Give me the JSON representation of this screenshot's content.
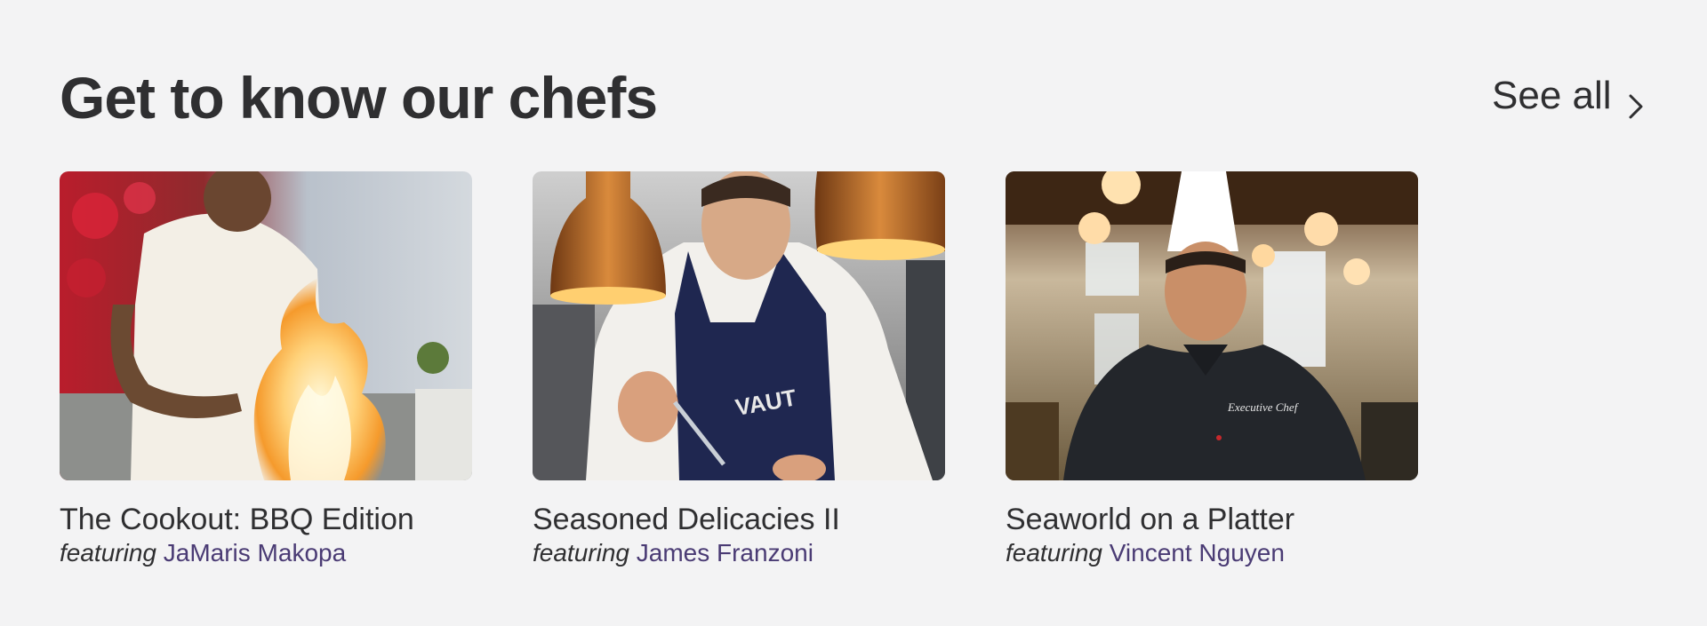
{
  "section": {
    "title": "Get to know our chefs",
    "see_all_label": "See all"
  },
  "cards": [
    {
      "title": "The Cookout: BBQ Edition",
      "featuring_label": "featuring",
      "chef_name": "JaMaris Makopa",
      "image_alt": "Chef flambéing food over a large flame"
    },
    {
      "title": "Seasoned Delicacies II",
      "featuring_label": "featuring",
      "chef_name": "James Franzoni",
      "image_alt": "Chef in apron plating under copper heat lamps"
    },
    {
      "title": "Seaworld on a Platter",
      "featuring_label": "featuring",
      "chef_name": "Vincent Nguyen",
      "image_alt": "Smiling chef wearing a tall white toque in a restaurant"
    }
  ],
  "icons": {
    "see_all": "chevron-right-icon"
  },
  "colors": {
    "background": "#f3f3f4",
    "text": "#2f2f31",
    "accent": "#4a3b74"
  }
}
